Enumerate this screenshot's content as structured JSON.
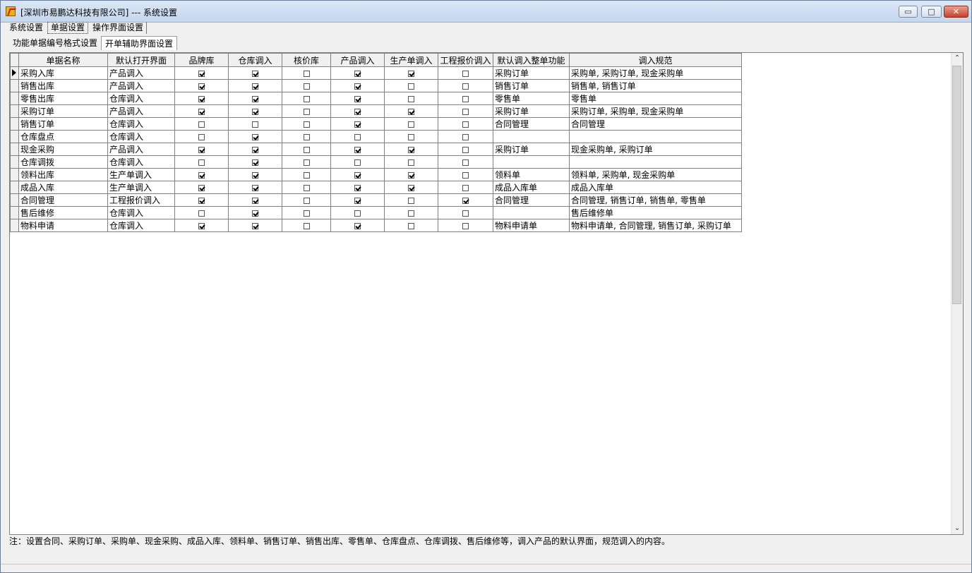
{
  "window": {
    "title": "[深圳市易鹏达科技有限公司] --- 系统设置",
    "min_label": "▭",
    "max_label": "□",
    "close_label": "✕"
  },
  "tabs1": [
    "系统设置",
    "单据设置",
    "操作界面设置"
  ],
  "tabs2": [
    "功能单据编号格式设置",
    "开单辅助界面设置"
  ],
  "grid": {
    "columns": [
      "单据名称",
      "默认打开界面",
      "品牌库",
      "仓库调入",
      "核价库",
      "产品调入",
      "生产单调入",
      "工程报价调入",
      "默认调入整单功能",
      "调入规范"
    ],
    "rows": [
      {
        "name": "采购入库",
        "open": "产品调入",
        "checks": [
          true,
          true,
          false,
          true,
          true,
          false
        ],
        "func": "采购订单",
        "spec": "采购单, 采购订单, 现金采购单",
        "current": true
      },
      {
        "name": "销售出库",
        "open": "产品调入",
        "checks": [
          true,
          true,
          false,
          true,
          false,
          false
        ],
        "func": "销售订单",
        "spec": "销售单, 销售订单"
      },
      {
        "name": "零售出库",
        "open": "仓库调入",
        "checks": [
          true,
          true,
          false,
          true,
          false,
          false
        ],
        "func": "零售单",
        "spec": "零售单"
      },
      {
        "name": "采购订单",
        "open": "产品调入",
        "checks": [
          true,
          true,
          false,
          true,
          true,
          false
        ],
        "func": "采购订单",
        "spec": "采购订单, 采购单, 现金采购单"
      },
      {
        "name": "销售订单",
        "open": "仓库调入",
        "checks": [
          false,
          false,
          false,
          true,
          false,
          false
        ],
        "func": "合同管理",
        "spec": "合同管理"
      },
      {
        "name": "仓库盘点",
        "open": "仓库调入",
        "checks": [
          false,
          true,
          false,
          false,
          false,
          false
        ],
        "func": "",
        "spec": ""
      },
      {
        "name": "现金采购",
        "open": "产品调入",
        "checks": [
          true,
          true,
          false,
          true,
          true,
          false
        ],
        "func": "采购订单",
        "spec": "现金采购单, 采购订单"
      },
      {
        "name": "仓库调拨",
        "open": "仓库调入",
        "checks": [
          false,
          true,
          false,
          false,
          false,
          false
        ],
        "func": "",
        "spec": ""
      },
      {
        "name": "领料出库",
        "open": "生产单调入",
        "checks": [
          true,
          true,
          false,
          true,
          true,
          false
        ],
        "func": "领料单",
        "spec": "领料单, 采购单, 现金采购单"
      },
      {
        "name": "成品入库",
        "open": "生产单调入",
        "checks": [
          true,
          true,
          false,
          true,
          true,
          false
        ],
        "func": "成品入库单",
        "spec": "成品入库单"
      },
      {
        "name": "合同管理",
        "open": "工程报价调入",
        "checks": [
          true,
          true,
          false,
          true,
          false,
          true
        ],
        "func": "合同管理",
        "spec": "合同管理, 销售订单, 销售单, 零售单"
      },
      {
        "name": "售后维修",
        "open": "仓库调入",
        "checks": [
          false,
          true,
          false,
          false,
          false,
          false
        ],
        "func": "",
        "spec": "售后维修单"
      },
      {
        "name": "物料申请",
        "open": "仓库调入",
        "checks": [
          true,
          true,
          false,
          true,
          false,
          false
        ],
        "func": "物料申请单",
        "spec": "物料申请单, 合同管理, 销售订单, 采购订单"
      }
    ]
  },
  "note": "注：设置合同、采购订单、采购单、现金采购、成品入库、领料单、销售订单、销售出库、零售单、仓库盘点、仓库调拨、售后维修等，调入产品的默认界面，规范调入的内容。"
}
